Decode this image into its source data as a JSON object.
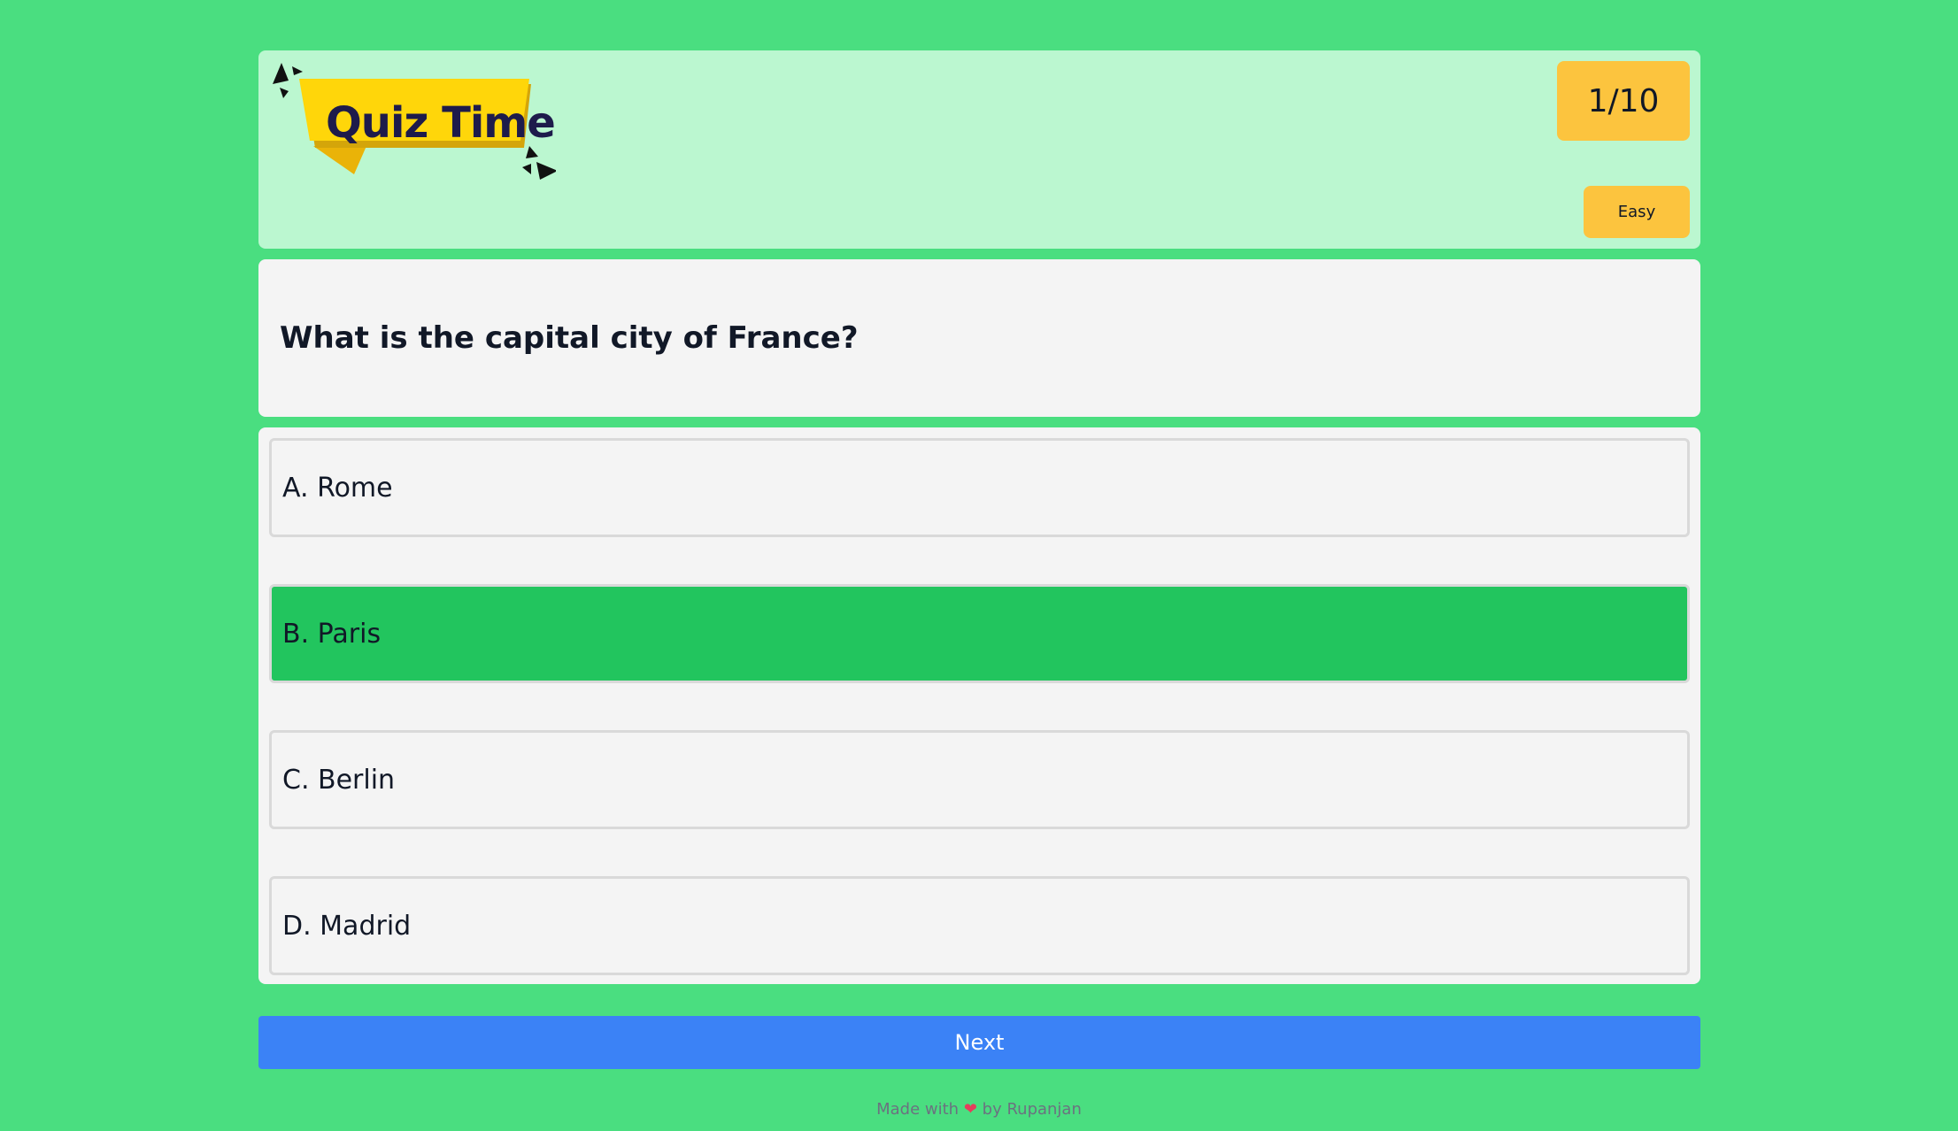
{
  "header": {
    "logo_text": "Quiz Time",
    "progress_label": "1/10",
    "difficulty_label": "Easy"
  },
  "question": {
    "text": "What is the capital city of France?"
  },
  "options": [
    {
      "label": "A. Rome",
      "selected": false
    },
    {
      "label": "B. Paris",
      "selected": true
    },
    {
      "label": "C. Berlin",
      "selected": false
    },
    {
      "label": "D. Madrid",
      "selected": false
    }
  ],
  "next_button_label": "Next",
  "footer": {
    "prefix": "Made with",
    "heart_icon": "heart-icon",
    "suffix": "by Rupanjan"
  },
  "colors": {
    "background": "#4ade80",
    "header_bg": "#bbf7d0",
    "badge": "#fcc43e",
    "selected_option": "#22c55e",
    "next_button": "#3b82f6",
    "logo_banner": "#fcd34d"
  }
}
